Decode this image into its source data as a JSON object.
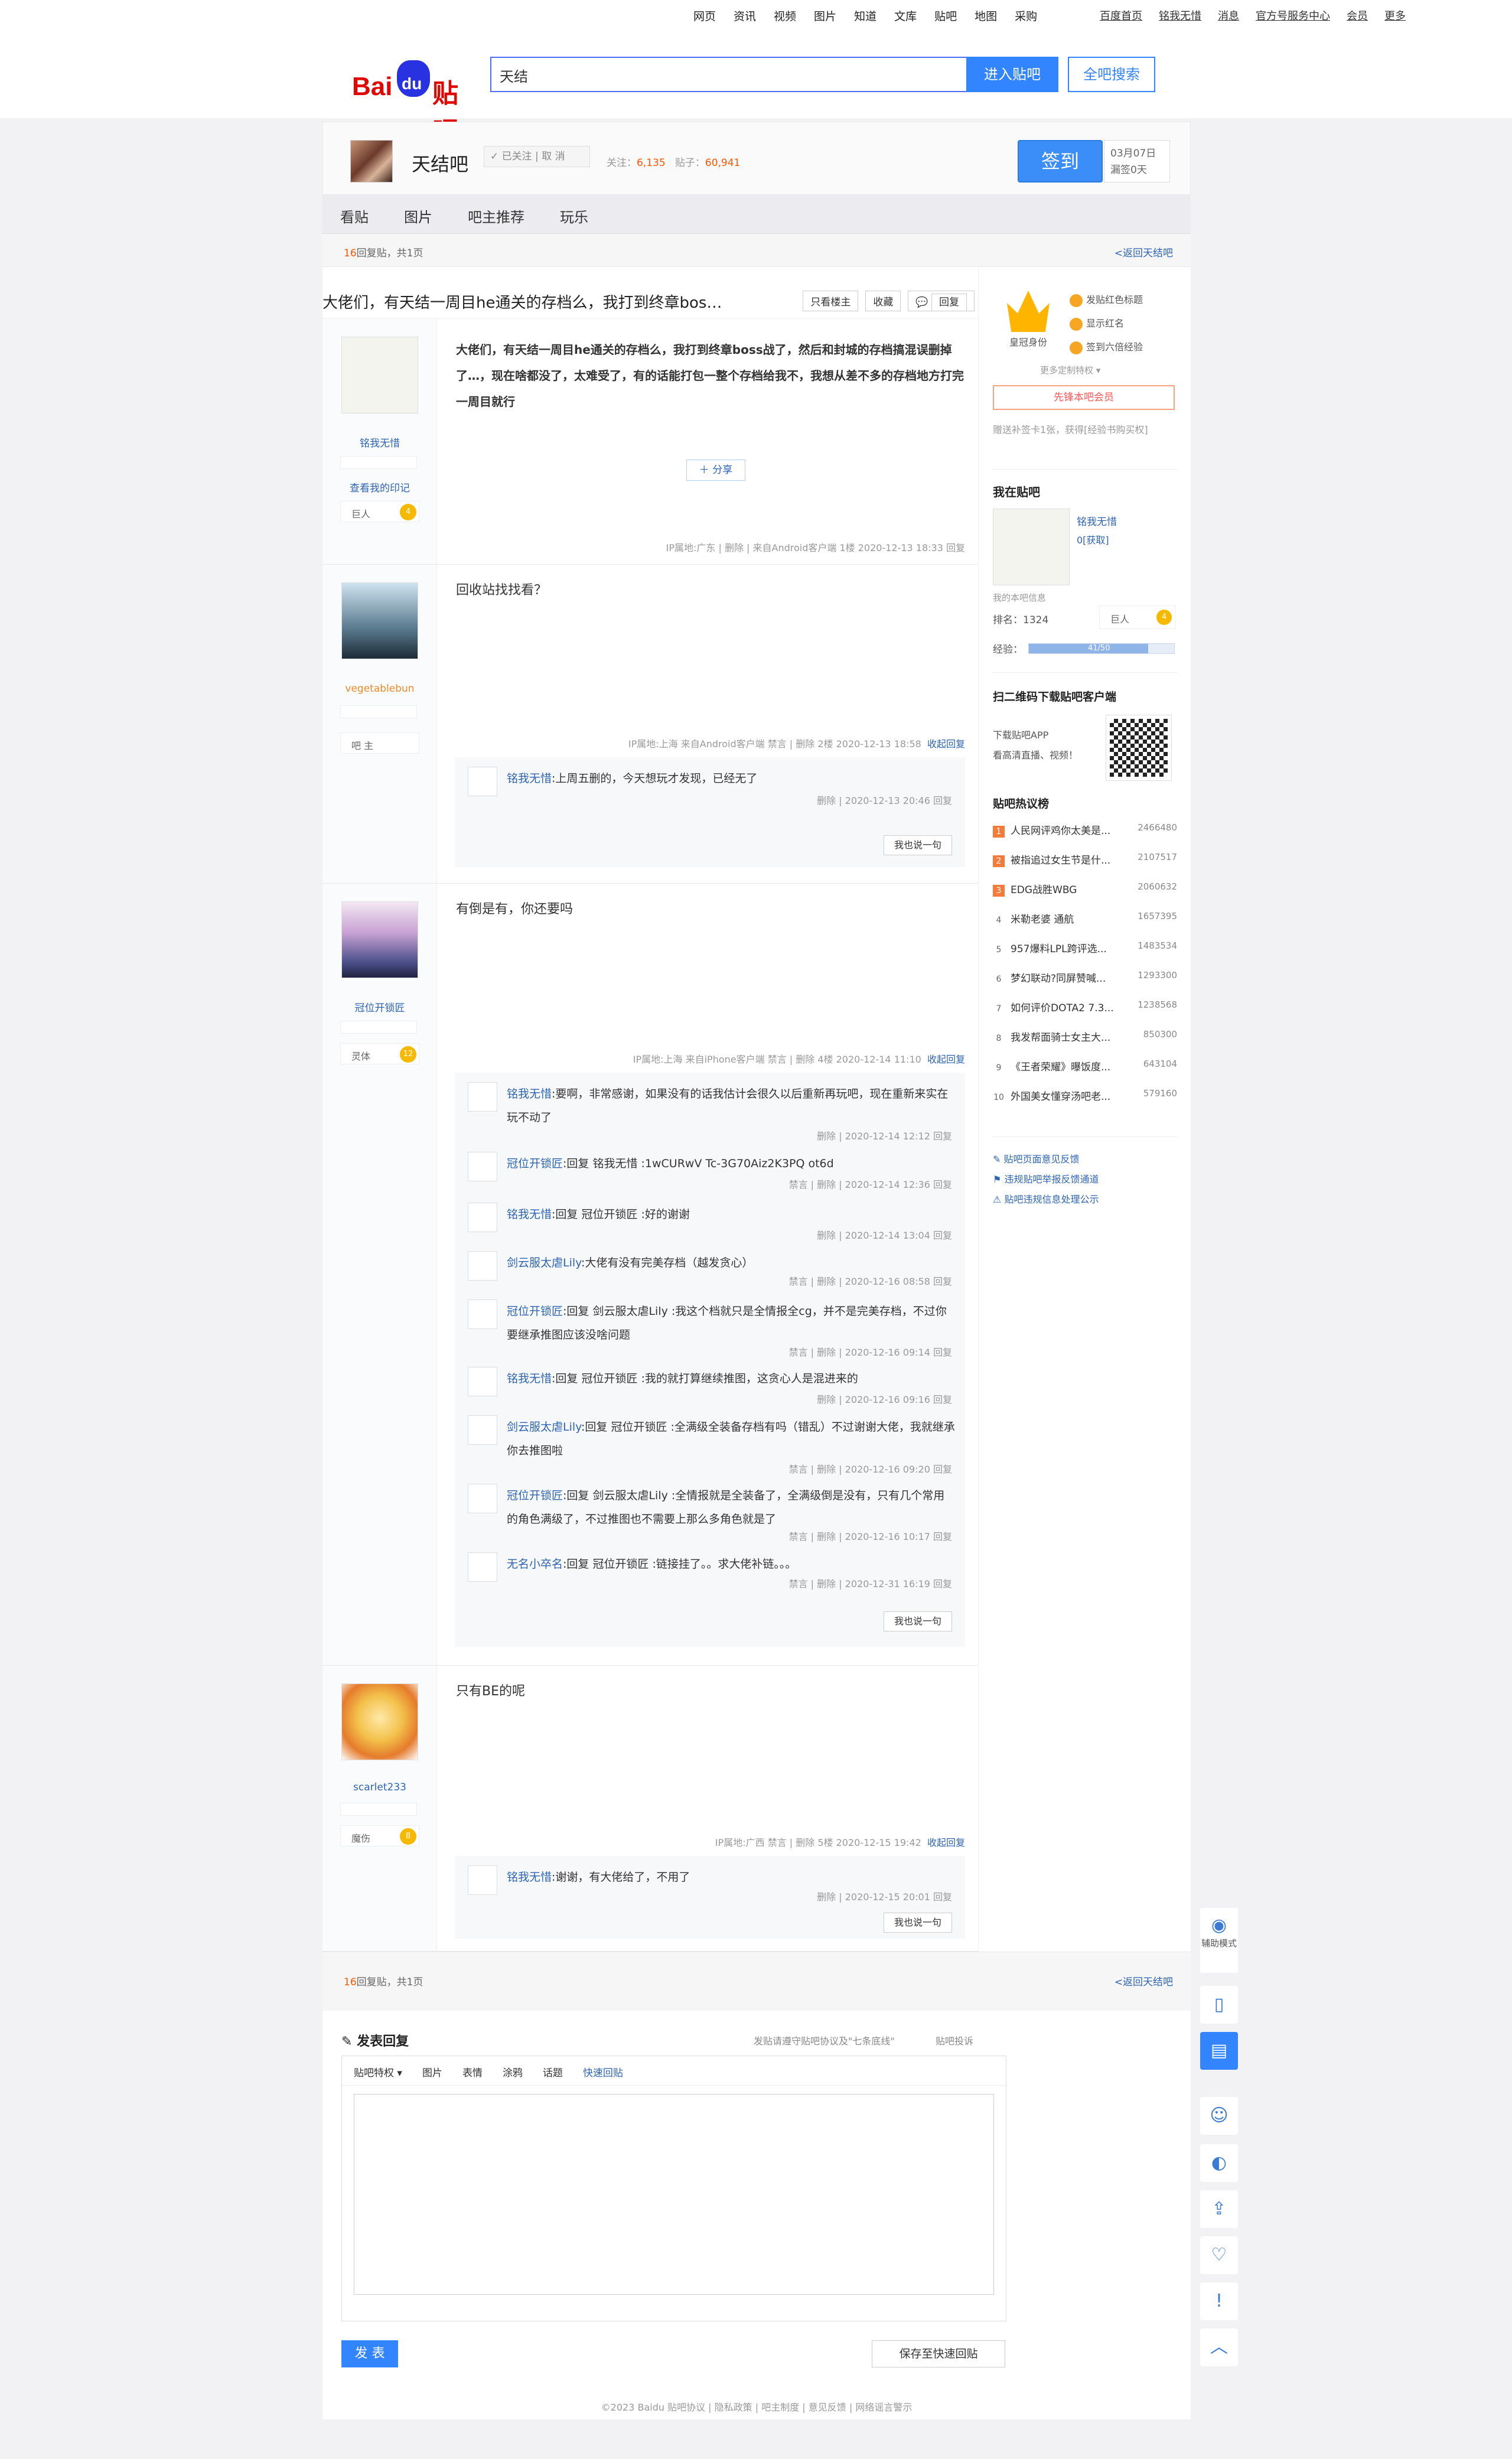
{
  "topnav": [
    "网页",
    "资讯",
    "视频",
    "图片",
    "知道",
    "文库",
    "贴吧",
    "地图",
    "采购"
  ],
  "toplinks": [
    "百度首页",
    "铭我无惜",
    "消息",
    "官方号服务中心",
    "会员",
    "更多"
  ],
  "search": {
    "value": "天结",
    "enter": "进入贴吧",
    "all": "全吧搜索"
  },
  "forum": {
    "name": "天结吧",
    "followed": "已关注",
    "cancel": "取 消",
    "fans_label": "关注：",
    "fans": "6,135",
    "posts_label": "贴子：",
    "posts": "60,941",
    "sign": "签到",
    "date": "03月07日",
    "missed": "漏签0天"
  },
  "tabs": [
    "看贴",
    "图片",
    "吧主推荐",
    "玩乐"
  ],
  "pagebar": {
    "count": "16",
    "left": "回复贴，共1页",
    "back": "<返回天结吧"
  },
  "thread": {
    "title": "大佬们，有天结一周目he通关的存档么，我打到终章bos…",
    "only_lz": "只看楼主",
    "collect": "收藏",
    "reply": "回复"
  },
  "posts": [
    {
      "user": "铭我无惜",
      "diary": "查看我的印记",
      "level_name": "巨人",
      "level": "4",
      "content": "大佬们，有天结一周目he通关的存档么，我打到终章boss战了，然后和封城的存档搞混误删掉了…，现在啥都没了，太难受了，有的话能打包一整个存档给我不，我想从差不多的存档地方打完一周目就行",
      "share": "分享",
      "meta": "IP属地:广东 | 删除 | 来自Android客户端  1楼  2020-12-13 18:33  回复"
    },
    {
      "user": "vegetablebun",
      "level_name": "吧 主",
      "content": "回收站找找看？",
      "meta": "IP属地:上海  来自Android客户端  禁言 | 删除  2楼  2020-12-13 18:58",
      "collapse": "收起回复",
      "replies": [
        {
          "u": "铭我无惜",
          "t": ":上周五删的，今天想玩才发现，已经无了",
          "m": "删除 | 2020-12-13 20:46  回复"
        }
      ],
      "say": "我也说一句"
    },
    {
      "user": "冠位开锁匠",
      "level_name": "灵体",
      "level": "12",
      "content": "有倒是有，你还要吗",
      "meta": "IP属地:上海  来自iPhone客户端  禁言 | 删除  4楼  2020-12-14 11:10",
      "collapse": "收起回复",
      "replies": [
        {
          "u": "铭我无惜",
          "t": ":要啊，非常感谢，如果没有的话我估计会很久以后重新再玩吧，现在重新来实在玩不动了",
          "m": "删除 | 2020-12-14 12:12  回复"
        },
        {
          "u": "冠位开锁匠",
          "t": ":回复 铭我无惜 :1wCURwV  Tc-3G70Aiz2K3PQ ot6d",
          "m": "禁言 | 删除 | 2020-12-14 12:36  回复"
        },
        {
          "u": "铭我无惜",
          "t": ":回复 冠位开锁匠 :好的谢谢",
          "m": "删除 | 2020-12-14 13:04  回复"
        },
        {
          "u": "剑云服太虐Lily",
          "t": ":大佬有没有完美存档（越发贪心）",
          "m": "禁言 | 删除 | 2020-12-16 08:58  回复"
        },
        {
          "u": "冠位开锁匠",
          "t": ":回复 剑云服太虐Lily :我这个档就只是全情报全cg，并不是完美存档，不过你要继承推图应该没啥问题",
          "m": "禁言 | 删除 | 2020-12-16 09:14  回复"
        },
        {
          "u": "铭我无惜",
          "t": ":回复 冠位开锁匠 :我的就打算继续推图，这贪心人是混进来的",
          "m": "删除 | 2020-12-16 09:16  回复"
        },
        {
          "u": "剑云服太虐Lily",
          "t": ":回复 冠位开锁匠 :全满级全装备存档有吗（错乱）不过谢谢大佬，我就继承你去推图啦",
          "m": "禁言 | 删除 | 2020-12-16 09:20  回复"
        },
        {
          "u": "冠位开锁匠",
          "t": ":回复 剑云服太虐Lily :全情报就是全装备了，全满级倒是没有，只有几个常用的角色满级了，不过推图也不需要上那么多角色就是了",
          "m": "禁言 | 删除 | 2020-12-16 10:17  回复"
        },
        {
          "u": "无名小卒名",
          "t": ":回复 冠位开锁匠 :链接挂了。。求大佬补链。。。",
          "m": "禁言 | 删除 | 2020-12-31 16:19  回复"
        }
      ],
      "say": "我也说一句"
    },
    {
      "user": "scarlet233",
      "level_name": "魔伤",
      "level": "8",
      "content": "只有BE的呢",
      "meta": "IP属地:广西  禁言 | 删除  5楼  2020-12-15 19:42",
      "collapse": "收起回复",
      "replies": [
        {
          "u": "铭我无惜",
          "t": ":谢谢，有大佬给了，不用了",
          "m": "删除 | 2020-12-15 20:01  回复"
        }
      ],
      "say": "我也说一句"
    }
  ],
  "right": {
    "crown_label": "皇冠身份",
    "privs": [
      "发贴红色标题",
      "显示红名",
      "签到六倍经验"
    ],
    "more_priv": "更多定制特权 ▾",
    "vip": "先锋本吧会员",
    "gift": "赠送补签卡1张，获得[经验书购买权]",
    "me_title": "我在贴吧",
    "me_name": "铭我无惜",
    "me_get": "0[获取]",
    "me_info": "我的本吧信息",
    "rank_label": "排名：",
    "rank": "1324",
    "lvl_name": "巨人",
    "lvl": "4",
    "exp_label": "经验：",
    "exp": "41/50",
    "exp_fraction": 0.82,
    "qr_title": "扫二维码下载贴吧客户端",
    "qr_l1": "下载贴吧APP",
    "qr_l2": "看高清直播、视频！",
    "hot_title": "贴吧热议榜",
    "hot": [
      {
        "n": "1",
        "t": "人民网评鸡你太美是...",
        "v": "2466480"
      },
      {
        "n": "2",
        "t": "被指追过女生节是什...",
        "v": "2107517"
      },
      {
        "n": "3",
        "t": "EDG战胜WBG",
        "v": "2060632"
      },
      {
        "n": "4",
        "t": "米勒老婆 通航",
        "v": "1657395"
      },
      {
        "n": "5",
        "t": "957爆料LPL跨评选...",
        "v": "1483534"
      },
      {
        "n": "6",
        "t": "梦幻联动?同屏赞喊...",
        "v": "1293300"
      },
      {
        "n": "7",
        "t": "如何评价DOTA2 7.3...",
        "v": "1238568"
      },
      {
        "n": "8",
        "t": "我发帮面骑士女主大...",
        "v": "850300"
      },
      {
        "n": "9",
        "t": "《王者荣耀》曝饭度...",
        "v": "643104"
      },
      {
        "n": "10",
        "t": "外国美女懂穿汤吧老...",
        "v": "579160"
      }
    ],
    "links": [
      "贴吧页面意见反馈",
      "违规贴吧举报反馈通道",
      "贴吧违规信息处理公示"
    ]
  },
  "bottom": {
    "count": "16",
    "left": "回复贴，共1页",
    "back": "<返回天结吧"
  },
  "reply": {
    "title": "发表回复",
    "rule": "发贴请遵守贴吧协议及\"七条底线\"",
    "complain": "贴吧投诉",
    "tools": [
      "贴吧特权 ▾",
      "图片",
      "表情",
      "涂鸦",
      "话题",
      "快速回贴"
    ],
    "post": "发 表",
    "save": "保存至快速回贴"
  },
  "footer": "©2023 Baidu 贴吧协议 | 隐私政策 | 吧主制度 | 意见反馈 | 网络谣言警示",
  "float": {
    "assist": "辅助模式"
  }
}
